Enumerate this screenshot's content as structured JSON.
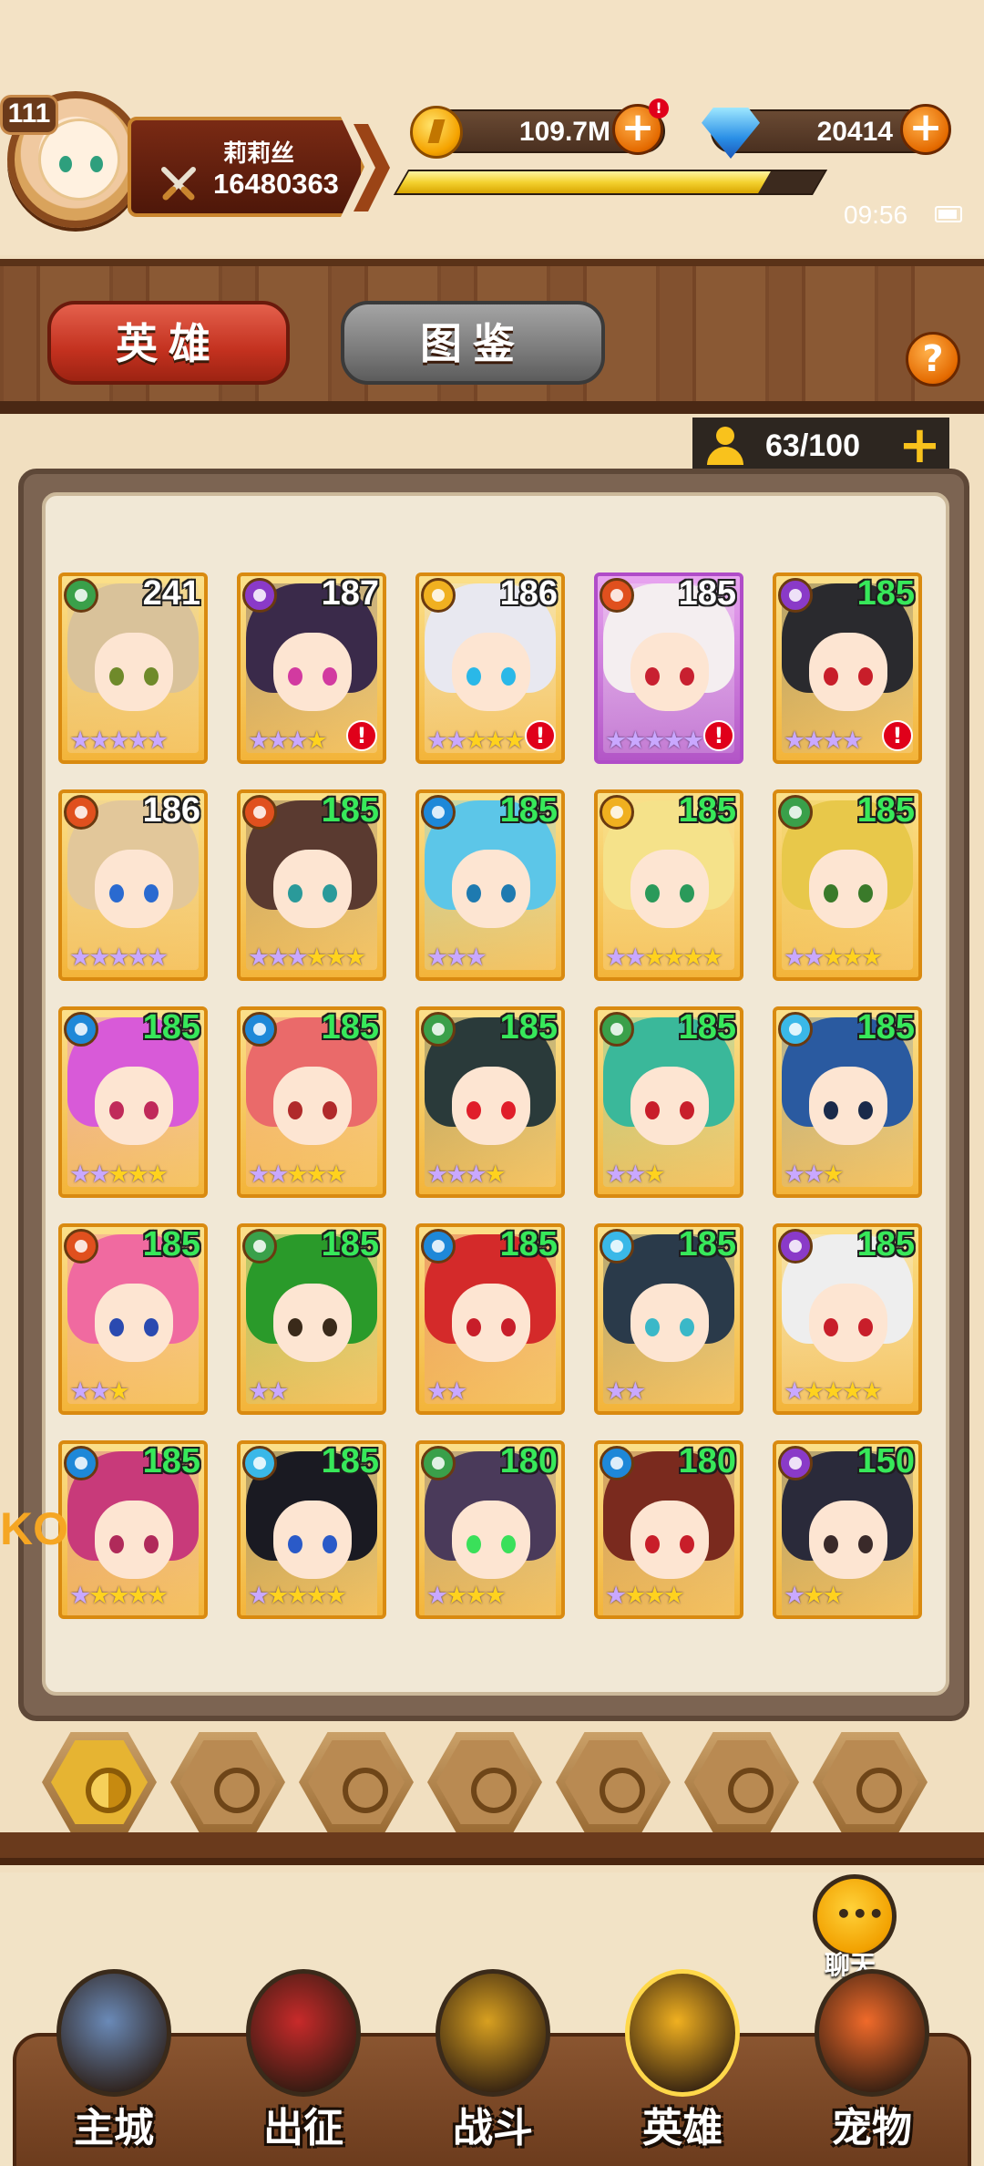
{
  "player": {
    "level": "111",
    "name": "莉莉丝",
    "power": "16480363",
    "xp_fraction": 0.87
  },
  "resources": {
    "gold": "109.7M",
    "gold_alert": "!",
    "gems": "20414"
  },
  "status": {
    "time": "09:56"
  },
  "tabs": [
    {
      "label": "英雄",
      "active": true
    },
    {
      "label": "图鉴",
      "active": false
    }
  ],
  "help_label": "?",
  "capacity": {
    "text": "63/100",
    "plus": "+"
  },
  "side_tab_text": "KO",
  "heroes": [
    {
      "level": "241",
      "level_color": "white",
      "element": "wood",
      "purple_stars": 5,
      "gold_stars": 0,
      "alert": false,
      "frame": "gold",
      "hair": "#d9c29a",
      "eyes": "#6f8a2a"
    },
    {
      "level": "187",
      "level_color": "white",
      "element": "dark",
      "purple_stars": 3,
      "gold_stars": 1,
      "alert": true,
      "frame": "gold",
      "hair": "#3a2a4a",
      "eyes": "#d23aa0"
    },
    {
      "level": "186",
      "level_color": "white",
      "element": "light",
      "purple_stars": 2,
      "gold_stars": 3,
      "alert": true,
      "frame": "gold",
      "hair": "#e8e8f0",
      "eyes": "#2ab8e8"
    },
    {
      "level": "185",
      "level_color": "white",
      "element": "fire",
      "purple_stars": 5,
      "gold_stars": 0,
      "alert": true,
      "frame": "purple",
      "hair": "#f4eef0",
      "eyes": "#c82030"
    },
    {
      "level": "185",
      "level_color": "green",
      "element": "dark",
      "purple_stars": 4,
      "gold_stars": 0,
      "alert": true,
      "frame": "gold",
      "hair": "#2a2a2e",
      "eyes": "#c81e2a"
    },
    {
      "level": "186",
      "level_color": "white",
      "element": "fire",
      "purple_stars": 5,
      "gold_stars": 0,
      "alert": false,
      "frame": "gold",
      "hair": "#e2c79a",
      "eyes": "#2a6ad0"
    },
    {
      "level": "185",
      "level_color": "green",
      "element": "fire",
      "purple_stars": 3,
      "gold_stars": 3,
      "alert": false,
      "frame": "gold",
      "hair": "#5a3a30",
      "eyes": "#2a9a9a"
    },
    {
      "level": "185",
      "level_color": "green",
      "element": "water",
      "purple_stars": 3,
      "gold_stars": 0,
      "alert": false,
      "frame": "gold",
      "hair": "#5cc6e8",
      "eyes": "#1e7ab0"
    },
    {
      "level": "185",
      "level_color": "green",
      "element": "light",
      "purple_stars": 2,
      "gold_stars": 4,
      "alert": false,
      "frame": "gold",
      "hair": "#f5e28a",
      "eyes": "#2a9a5a"
    },
    {
      "level": "185",
      "level_color": "green",
      "element": "wood",
      "purple_stars": 2,
      "gold_stars": 3,
      "alert": false,
      "frame": "gold",
      "hair": "#e8c84a",
      "eyes": "#3a7a2a"
    },
    {
      "level": "185",
      "level_color": "green",
      "element": "water",
      "purple_stars": 2,
      "gold_stars": 3,
      "alert": false,
      "frame": "gold",
      "hair": "#d85ad8",
      "eyes": "#c02a5a"
    },
    {
      "level": "185",
      "level_color": "green",
      "element": "water",
      "purple_stars": 2,
      "gold_stars": 3,
      "alert": false,
      "frame": "gold",
      "hair": "#ea6a6a",
      "eyes": "#b02a2a"
    },
    {
      "level": "185",
      "level_color": "green",
      "element": "wood",
      "purple_stars": 3,
      "gold_stars": 1,
      "alert": false,
      "frame": "gold",
      "hair": "#2a3a3a",
      "eyes": "#e01e2a"
    },
    {
      "level": "185",
      "level_color": "green",
      "element": "wood",
      "purple_stars": 2,
      "gold_stars": 1,
      "alert": false,
      "frame": "gold",
      "hair": "#3ab89a",
      "eyes": "#c81e2a"
    },
    {
      "level": "185",
      "level_color": "green",
      "element": "ice",
      "purple_stars": 2,
      "gold_stars": 1,
      "alert": false,
      "frame": "gold",
      "hair": "#2a5aa0",
      "eyes": "#1a2a4a"
    },
    {
      "level": "185",
      "level_color": "green",
      "element": "fire",
      "purple_stars": 2,
      "gold_stars": 1,
      "alert": false,
      "frame": "gold",
      "hair": "#f06aa0",
      "eyes": "#2a4ab0"
    },
    {
      "level": "185",
      "level_color": "green",
      "element": "wood",
      "purple_stars": 2,
      "gold_stars": 0,
      "alert": false,
      "frame": "gold",
      "hair": "#2a9a2a",
      "eyes": "#3a2a1a"
    },
    {
      "level": "185",
      "level_color": "green",
      "element": "water",
      "purple_stars": 2,
      "gold_stars": 0,
      "alert": false,
      "frame": "gold",
      "hair": "#d42a2a",
      "eyes": "#c81e2a"
    },
    {
      "level": "185",
      "level_color": "green",
      "element": "ice",
      "purple_stars": 2,
      "gold_stars": 0,
      "alert": false,
      "frame": "gold",
      "hair": "#2a3a4a",
      "eyes": "#3ab8c8"
    },
    {
      "level": "185",
      "level_color": "green",
      "element": "dark",
      "purple_stars": 1,
      "gold_stars": 4,
      "alert": false,
      "frame": "gold",
      "hair": "#eeeeee",
      "eyes": "#c81e2a"
    },
    {
      "level": "185",
      "level_color": "green",
      "element": "water",
      "purple_stars": 1,
      "gold_stars": 4,
      "alert": false,
      "frame": "gold",
      "hair": "#c83a7a",
      "eyes": "#b02a5a"
    },
    {
      "level": "185",
      "level_color": "green",
      "element": "ice",
      "purple_stars": 1,
      "gold_stars": 4,
      "alert": false,
      "frame": "gold",
      "hair": "#1a1a22",
      "eyes": "#2a5ac8"
    },
    {
      "level": "180",
      "level_color": "green",
      "element": "wood",
      "purple_stars": 1,
      "gold_stars": 3,
      "alert": false,
      "frame": "gold",
      "hair": "#4a3a5a",
      "eyes": "#3ae05a"
    },
    {
      "level": "180",
      "level_color": "green",
      "element": "water",
      "purple_stars": 1,
      "gold_stars": 3,
      "alert": false,
      "frame": "gold",
      "hair": "#7a2a1e",
      "eyes": "#c81e2a"
    },
    {
      "level": "150",
      "level_color": "green",
      "element": "dark",
      "purple_stars": 1,
      "gold_stars": 2,
      "alert": false,
      "frame": "gold",
      "hair": "#2a2a3a",
      "eyes": "#3a2a2a"
    }
  ],
  "element_colors": {
    "wood": "#3aa04a",
    "dark": "#8a3ac8",
    "light": "#f0b020",
    "fire": "#e0501e",
    "water": "#1e88d8",
    "ice": "#3ab8e8"
  },
  "filters": [
    {
      "name": "all-elements",
      "active": true
    },
    {
      "name": "fire",
      "active": false
    },
    {
      "name": "ice",
      "active": false
    },
    {
      "name": "water",
      "active": false
    },
    {
      "name": "wood",
      "active": false
    },
    {
      "name": "dark",
      "active": false
    },
    {
      "name": "light",
      "active": false
    }
  ],
  "chat_label": "聊天",
  "nav": [
    {
      "label": "主城",
      "icon": "castle-tower-icon",
      "color": "#6a8ab8"
    },
    {
      "label": "出征",
      "icon": "red-crystal-icon",
      "color": "#c82a2a"
    },
    {
      "label": "战斗",
      "icon": "crossed-swords-shield-icon",
      "color": "#d8a020"
    },
    {
      "label": "英雄",
      "icon": "golden-helmet-icon",
      "color": "#f0b020"
    },
    {
      "label": "宠物",
      "icon": "dragon-pet-icon",
      "color": "#f06a2a"
    }
  ]
}
